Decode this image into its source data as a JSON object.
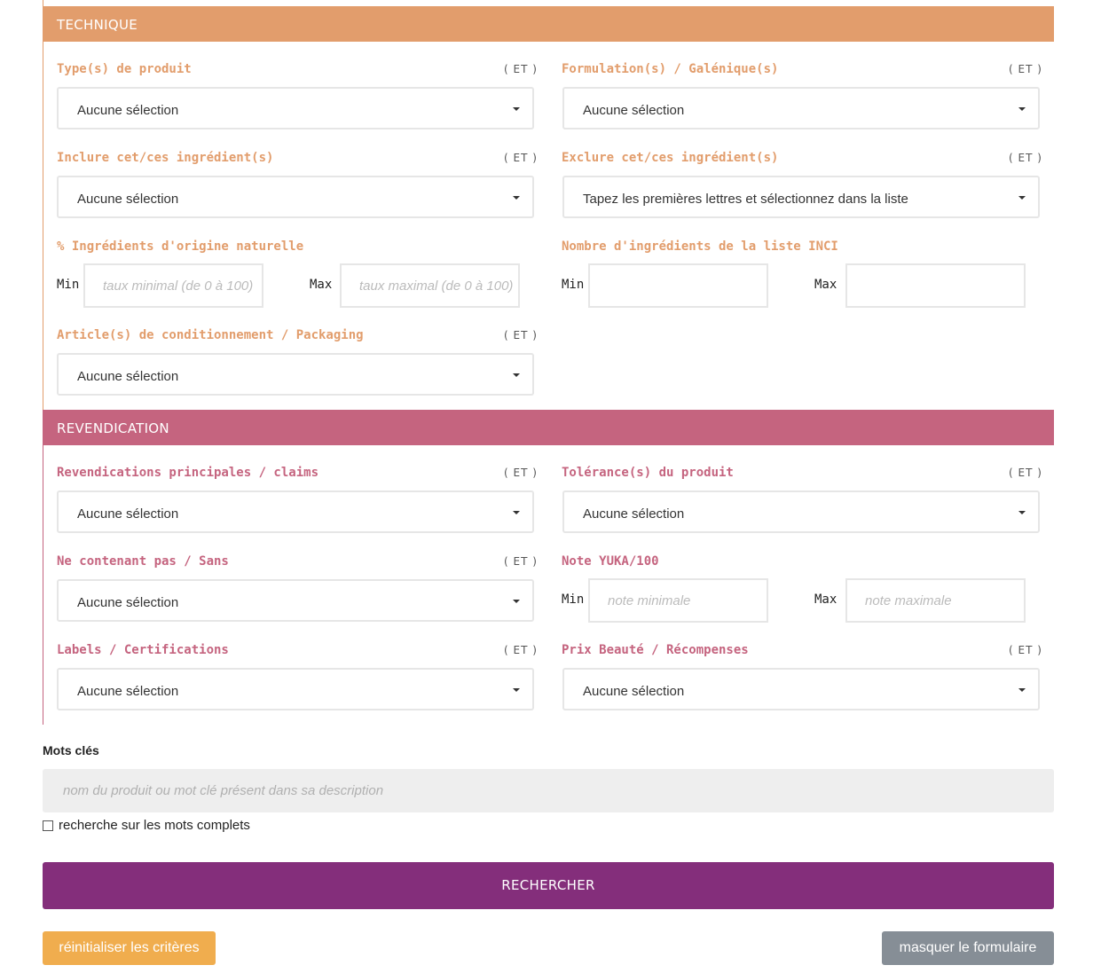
{
  "colors": {
    "technique": "#e29d6c",
    "revendication": "#c5647f",
    "search_button": "#842e7b",
    "reset_button": "#f0ad4e",
    "hide_button": "#868e96"
  },
  "technique": {
    "title": "TECHNIQUE",
    "product_types": {
      "label": "Type(s) de produit",
      "op": "( ET )",
      "value": "Aucune sélection"
    },
    "formulations": {
      "label": "Formulation(s) / Galénique(s)",
      "op": "( ET )",
      "value": "Aucune sélection"
    },
    "include_ingredients": {
      "label": "Inclure cet/ces ingrédient(s)",
      "op": "( ET )",
      "value": "Aucune sélection"
    },
    "exclude_ingredients": {
      "label": "Exclure cet/ces ingrédient(s)",
      "op": "( ET )",
      "value": "Tapez les premières lettres et sélectionnez dans la liste"
    },
    "natural_origin": {
      "label": "% Ingrédients d'origine naturelle",
      "min_label": "Min",
      "max_label": "Max",
      "min_placeholder": "taux minimal (de 0 à 100)",
      "max_placeholder": "taux maximal (de 0 à 100)"
    },
    "inci_count": {
      "label": "Nombre d'ingrédients de la liste INCI",
      "min_label": "Min",
      "max_label": "Max"
    },
    "packaging": {
      "label": "Article(s) de conditionnement / Packaging",
      "op": "( ET )",
      "value": "Aucune sélection"
    }
  },
  "revendication": {
    "title": "REVENDICATION",
    "claims": {
      "label": "Revendications principales / claims",
      "op": "( ET )",
      "value": "Aucune sélection"
    },
    "tolerances": {
      "label": "Tolérance(s) du produit",
      "op": "( ET )",
      "value": "Aucune sélection"
    },
    "without": {
      "label": "Ne contenant pas / Sans",
      "op": "( ET )",
      "value": "Aucune sélection"
    },
    "yuka": {
      "label": "Note YUKA/100",
      "min_label": "Min",
      "max_label": "Max",
      "min_placeholder": "note minimale",
      "max_placeholder": "note maximale"
    },
    "labels": {
      "label": "Labels / Certifications",
      "op": "( ET )",
      "value": "Aucune sélection"
    },
    "awards": {
      "label": "Prix Beauté / Récompenses",
      "op": "( ET )",
      "value": "Aucune sélection"
    }
  },
  "keywords": {
    "label": "Mots clés",
    "placeholder": "nom du produit ou mot clé présent dans sa description",
    "whole_words_label": "recherche sur les mots complets"
  },
  "actions": {
    "search": "RECHERCHER",
    "reset": "réinitialiser les critères",
    "hide": "masquer le formulaire"
  }
}
